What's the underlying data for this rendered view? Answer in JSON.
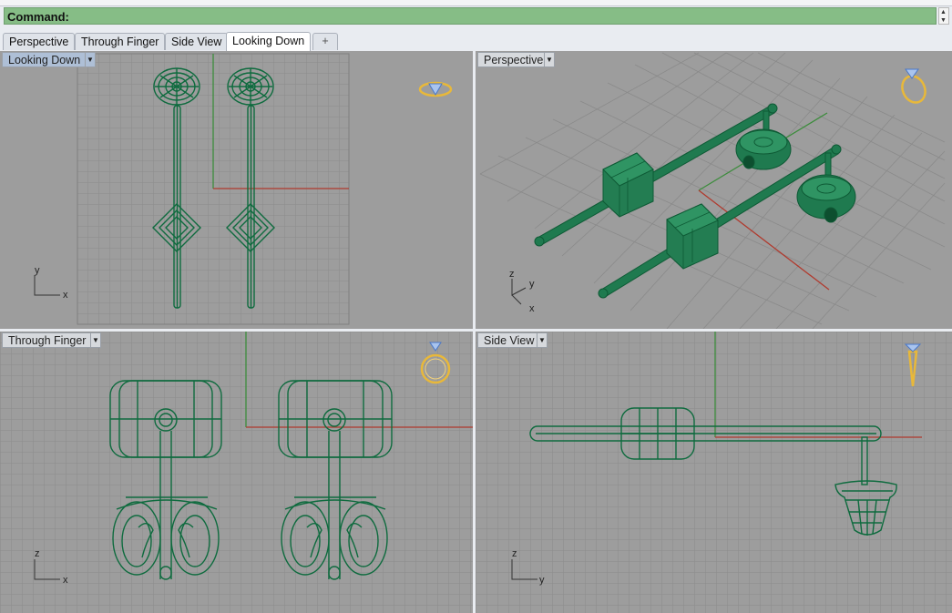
{
  "command_bar": {
    "label": "Command:"
  },
  "tabs": [
    {
      "label": "Perspective",
      "active": false
    },
    {
      "label": "Through Finger",
      "active": false
    },
    {
      "label": "Side View",
      "active": false
    },
    {
      "label": "Looking Down",
      "active": true
    }
  ],
  "new_tab_label": "+",
  "viewports": {
    "looking_down": {
      "title": "Looking Down",
      "axis_x": "x",
      "axis_y": "y",
      "active": true
    },
    "perspective": {
      "title": "Perspective",
      "axis_x": "x",
      "axis_y": "y",
      "axis_z": "z"
    },
    "through_finger": {
      "title": "Through Finger",
      "axis_x": "x",
      "axis_z": "z"
    },
    "side_view": {
      "title": "Side View",
      "axis_y": "y",
      "axis_z": "z"
    }
  },
  "colors": {
    "viewport_bg": "#9d9d9d",
    "grid_minor": "#8b8b8b",
    "grid_major": "#7d7d7d",
    "model_fill": "#1f7a4f",
    "model_wire": "#0e5a35",
    "axis_x": "#b03a2e",
    "axis_y": "#3c8c3c",
    "icon_ring": "#e8b83a",
    "icon_gem": "#4a78c8",
    "command_bar": "#86bd86"
  },
  "icons": [
    "ring-gem-icon",
    "dropdown-arrow-icon"
  ]
}
